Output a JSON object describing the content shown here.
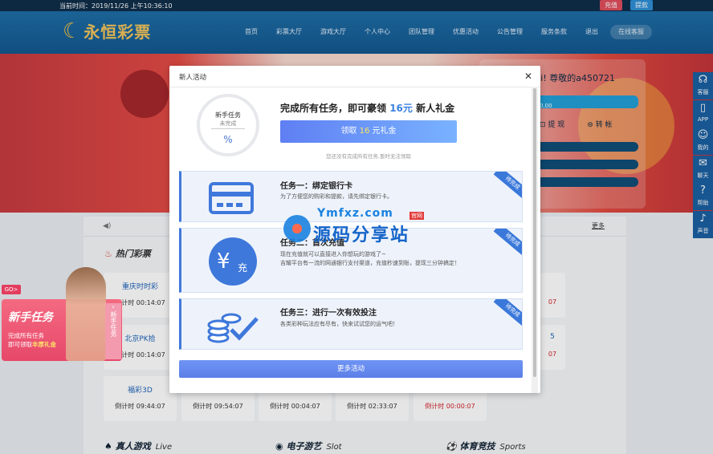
{
  "topbar": {
    "time": "当前时间：2019/11/26 上午10:36:10",
    "recharge": "充值",
    "withdraw": "提款"
  },
  "header": {
    "logo_text": "永恒彩票",
    "nav": [
      "首页",
      "彩票大厅",
      "游戏大厅",
      "个人中心",
      "团队管理",
      "优惠活动",
      "公告管理",
      "服务条款",
      "退出"
    ],
    "service": "在线客服"
  },
  "user_panel": {
    "greeting": "Hi! 尊敬的a450721",
    "balance": "0.00",
    "withdraw": "提 现",
    "transfer": "转 帐"
  },
  "right_sidebar": [
    {
      "label": "客服",
      "icon": "headset-icon"
    },
    {
      "label": "APP",
      "icon": "phone-icon"
    },
    {
      "label": "我的",
      "icon": "user-icon"
    },
    {
      "label": "聊天",
      "icon": "chat-icon"
    },
    {
      "label": "帮助",
      "icon": "help-icon"
    },
    {
      "label": "声音",
      "icon": "sound-icon"
    }
  ],
  "content": {
    "more": "更多",
    "hot_lottery": "热门彩票",
    "lotteries": [
      {
        "name": "重庆时时彩",
        "countdown": "倒计时 00:14:07",
        "red": false
      },
      {
        "name": "北京PK拾",
        "countdown": "倒计时 00:14:07",
        "red": false
      },
      {
        "name": "福彩3D",
        "countdown": "倒计时 09:44:07",
        "red": false
      },
      {
        "name": "",
        "countdown": "倒计时 09:54:07",
        "red": false
      },
      {
        "name": "",
        "countdown": "倒计时 00:04:07",
        "red": false
      },
      {
        "name": "",
        "countdown": "倒计时 02:33:07",
        "red": false
      },
      {
        "name": "",
        "countdown": "倒计时 00:00:07",
        "red": true
      }
    ],
    "right_partial": [
      "07",
      "5",
      "07"
    ],
    "sections": [
      {
        "title": "真人游戏",
        "en": "Live"
      },
      {
        "title": "电子游艺",
        "en": "Slot"
      },
      {
        "title": "体育竞技",
        "en": "Sports"
      }
    ]
  },
  "promo": {
    "go": "GO>",
    "title": "新手任务",
    "line1": "完成所有任务",
    "line2_prefix": "即可领取",
    "line2_highlight": "丰厚礼金",
    "tab": "新手任务"
  },
  "modal": {
    "title": "新人活动",
    "ring_title": "新手任务",
    "ring_status": "未完成",
    "ring_percent": "%",
    "headline_prefix": "完成所有任务，即可豪领 ",
    "headline_amount": "16元",
    "headline_suffix": " 新人礼金",
    "claim_prefix": "领取 ",
    "claim_amount": "16",
    "claim_suffix": " 元礼金",
    "hint": "您还没有完成所有任务,暂时无法领取",
    "tasks": [
      {
        "title": "任务一：绑定银行卡",
        "desc": "为了方便您的购彩和提款，请先绑定银行卡。",
        "ribbon": "待完成",
        "icon": "bank-card-icon"
      },
      {
        "title": "任务二：首次充值",
        "desc": "现在充值就可以直接进入你想玩的游戏了~\n吉耀平台有一流的网通银行支付渠道，充值秒速到账，提现三分钟搞定！",
        "ribbon": "待完成",
        "icon": "yuan-recharge-icon"
      },
      {
        "title": "任务三：进行一次有效投注",
        "desc": "各类彩种玩法应有尽有，快来试试您的运气吧！",
        "ribbon": "待完成",
        "icon": "coins-check-icon"
      }
    ],
    "more_button": "更多活动"
  },
  "watermark": {
    "top": "Ymfxz.com",
    "badge": "官网",
    "main": "源码分享站"
  }
}
